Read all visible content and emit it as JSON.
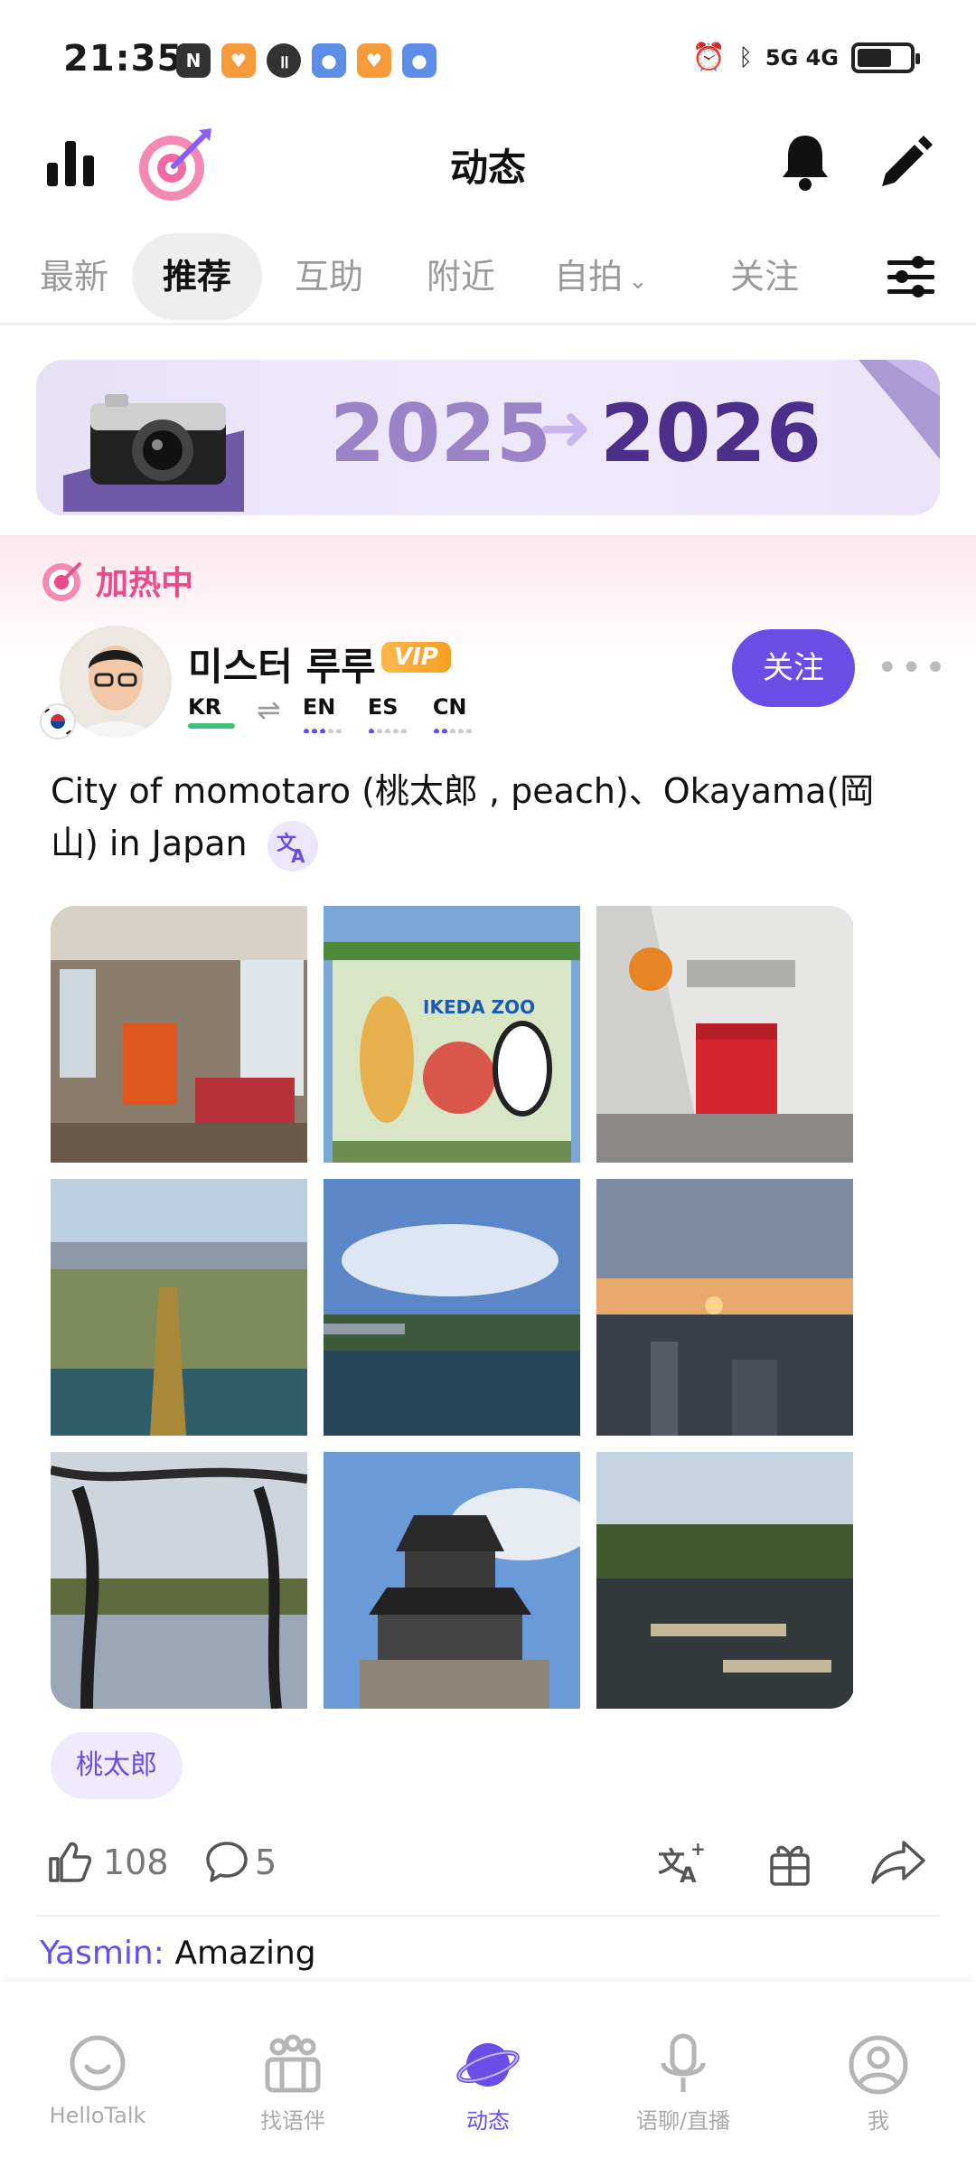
{
  "status_bar": {
    "time": "21:35",
    "right_indicators": "5G 4G"
  },
  "header": {
    "title": "动态"
  },
  "tabs": [
    {
      "label": "最新",
      "active": false
    },
    {
      "label": "推荐",
      "active": true
    },
    {
      "label": "互助",
      "active": false
    },
    {
      "label": "附近",
      "active": false
    },
    {
      "label": "自拍",
      "active": false,
      "has_dropdown": true
    },
    {
      "label": "关注",
      "active": false
    }
  ],
  "banner": {
    "year_from": "2025",
    "arrow": "➜",
    "year_to": "2026"
  },
  "post": {
    "boost_label": "加热中",
    "username": "미스터 루루",
    "vip_badge": "VIP",
    "native_lang": "KR",
    "learning_langs": [
      "EN",
      "ES",
      "CN"
    ],
    "follow_label": "关注",
    "more_label": "•••",
    "text": "City of momotaro (桃太郎 , peach)、Okayama(岡山) in Japan",
    "photo_labels": [
      "",
      "IKEDA ZOO",
      "",
      "",
      "",
      "",
      "",
      "",
      ""
    ],
    "tag": "桃太郎",
    "like_count": "108",
    "comment_count": "5",
    "comment_author": "Yasmin:",
    "comment_text": "Amazing"
  },
  "bottom_nav": [
    {
      "label": "HelloTalk",
      "icon": "chat-bubble-icon",
      "active": false
    },
    {
      "label": "找语伴",
      "icon": "people-icon",
      "active": false
    },
    {
      "label": "动态",
      "icon": "planet-icon",
      "active": true
    },
    {
      "label": "语聊/直播",
      "icon": "microphone-icon",
      "active": false
    },
    {
      "label": "我",
      "icon": "profile-icon",
      "active": false
    }
  ],
  "colors": {
    "accent": "#6a4de6",
    "boost": "#ec4a8c",
    "vip": "#f59f21"
  }
}
